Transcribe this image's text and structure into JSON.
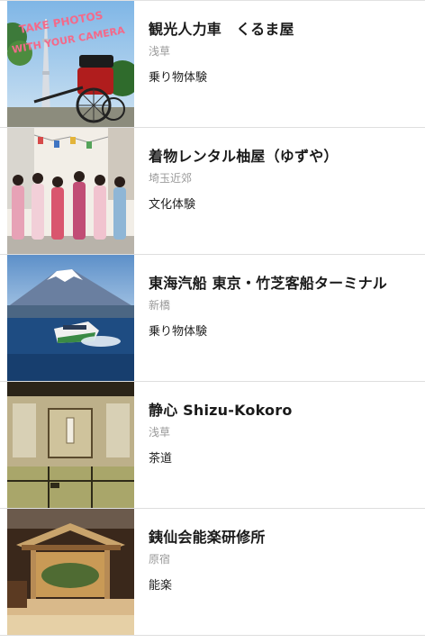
{
  "listings": [
    {
      "title": "観光人力車　くるま屋",
      "area": "浅草",
      "category": "乗り物体験",
      "photo_text": "TAKE PHOTOS\nWITH YOUR CAMERA"
    },
    {
      "title": "着物レンタル柚屋（ゆずや）",
      "area": "埼玉近郊",
      "category": "文化体験"
    },
    {
      "title": "東海汽船 東京・竹芝客船ターミナル",
      "area": "新橋",
      "category": "乗り物体験"
    },
    {
      "title": "静心 Shizu-Kokoro",
      "area": "浅草",
      "category": "茶道"
    },
    {
      "title": "銕仙会能楽研修所",
      "area": "原宿",
      "category": "能楽"
    }
  ]
}
